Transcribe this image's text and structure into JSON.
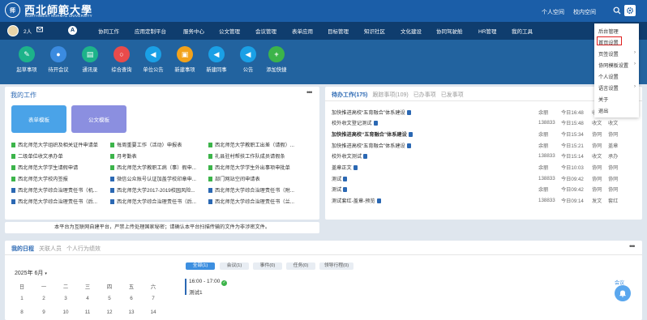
{
  "header": {
    "logo_text": "西北師範大學",
    "logo_text_en": "NORTHWEST NORMAL UNIVERSITY",
    "personal_space": "个人空间",
    "school_space": "校内空间"
  },
  "nav": {
    "user_count": "2人",
    "items": [
      "协同工作",
      "应用定制平台",
      "服务中心",
      "公文管理",
      "会议管理",
      "表单应用",
      "目标管理",
      "知识社区",
      "文化建设",
      "协同驾驶舱",
      "HR管理",
      "我的工具"
    ]
  },
  "quick": [
    {
      "label": "起草事项",
      "color": "#1db38a"
    },
    {
      "label": "待开会议",
      "color": "#3b8be0"
    },
    {
      "label": "通讯录",
      "color": "#1db38a"
    },
    {
      "label": "综合查询",
      "color": "#e94b4b"
    },
    {
      "label": "单位公告",
      "color": "#1aa0e6"
    },
    {
      "label": "新建事项",
      "color": "#f2a21b"
    },
    {
      "label": "新建同事",
      "color": "#1aa0e6"
    },
    {
      "label": "公告",
      "color": "#1aa0e6"
    },
    {
      "label": "添加快捷",
      "color": "#3cb44a"
    }
  ],
  "work": {
    "title": "我的工作",
    "templates": [
      "表单模板",
      "公文模板"
    ],
    "items": [
      [
        "西北师范大学组织及相关证件申请单",
        "每周重要工作（活动）申报表",
        "西北师范大学教职工出差（请假）..."
      ],
      [
        "二级单位收文承办单",
        "月考勤表",
        "礼县驻村帮扶工作队成员请假条"
      ],
      [
        "西北师范大学学生请假申请",
        "西北师范大学教职工病（事）假申...",
        "西北师范大学学生外出事项申批单"
      ],
      [
        "西北师范大学校内签报",
        "微信公众账号认证加盖学校印章申...",
        "部门网站空间申请表"
      ],
      [
        "西北师范大学综合治理责任书（机...",
        "西北师范大学2017-2019校园风险...",
        "西北师范大学综合治理责任书（附..."
      ],
      [
        "西北师范大学综合治理责任书（后...",
        "西北师范大学综合治理责任书（后...",
        "西北师范大学综合治理责任书（兰..."
      ]
    ]
  },
  "todo": {
    "tabs": [
      "待办工作(175)",
      "跟踪事项(109)",
      "已办事项",
      "已发事项"
    ],
    "rows": [
      {
        "title": "加快推进高校“五育融合”体系建设",
        "user": "余丽",
        "time": "今日16:48",
        "a": "收文",
        "b": "协同",
        "bold": false
      },
      {
        "title": "校外收文登记测试",
        "user": "138833",
        "time": "今日15:48",
        "a": "收文",
        "b": "收文",
        "bold": false
      },
      {
        "title": "加快推进高校“五育融合”体系建设",
        "user": "余丽",
        "time": "今日15:34",
        "a": "协同",
        "b": "协同",
        "bold": true
      },
      {
        "title": "加快推进高校“五育融合”体系建设",
        "user": "余丽",
        "time": "今日15:21",
        "a": "协同",
        "b": "盖章",
        "bold": false
      },
      {
        "title": "校外收文测试",
        "user": "138833",
        "time": "今日15:14",
        "a": "收文",
        "b": "承办",
        "bold": false
      },
      {
        "title": "盖章正文",
        "user": "余丽",
        "time": "今日10:03",
        "a": "协同",
        "b": "协同",
        "bold": false
      },
      {
        "title": "测试",
        "user": "138833",
        "time": "今日09:42",
        "a": "协同",
        "b": "协同",
        "bold": false
      },
      {
        "title": "测试",
        "user": "余丽",
        "time": "今日09:42",
        "a": "协同",
        "b": "协同",
        "bold": false
      },
      {
        "title": "测试套红-盖章-预览",
        "user": "138833",
        "time": "今日09:14",
        "a": "发文",
        "b": "套红",
        "bold": false
      }
    ]
  },
  "notice": "本平台为互联网自建平台，严禁上传处理国家秘密；请确认本平台扫描传输的文件为非涉密文件。",
  "schedule": {
    "tabs": [
      "我的日程",
      "关联人员",
      "个人行为绩效"
    ],
    "month": "2025年 6月",
    "weekdays": [
      "日",
      "一",
      "二",
      "三",
      "四",
      "五",
      "六"
    ],
    "weeks": [
      [
        "1",
        "2",
        "3",
        "4",
        "5",
        "6",
        "7"
      ],
      [
        "8",
        "9",
        "10",
        "11",
        "12",
        "13",
        "14"
      ]
    ],
    "filters": [
      "全部(1)",
      "会议(1)",
      "事件(0)",
      "任务(0)",
      "领导行程(0)"
    ],
    "event_time": "16:00 - 17:00",
    "event_title": "测试1",
    "side_label": "会议"
  },
  "menu": {
    "items": [
      "后台管理",
      "首页设置",
      "页签设置",
      "协同模板设置",
      "个人设置",
      "语言设置",
      "关于",
      "退出"
    ]
  }
}
